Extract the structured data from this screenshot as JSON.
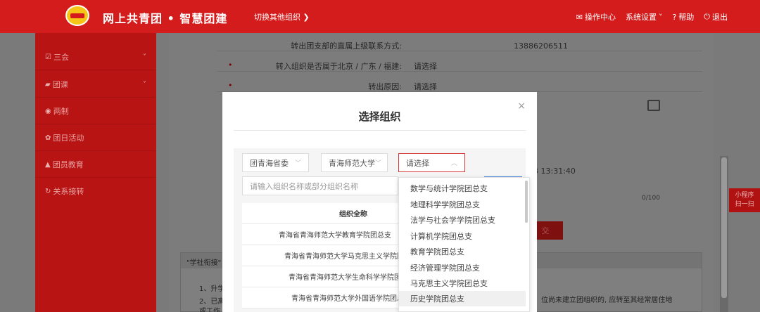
{
  "header": {
    "site_title": "网上共青团 • 智慧团建",
    "switch_org": "切换其他组织",
    "ops_center": "操作中心",
    "settings": "系统设置",
    "help": "帮助",
    "logout": "退出"
  },
  "sidebar": {
    "items": [
      {
        "label": "三会",
        "icon": "checkbox-icon",
        "has_arrow": true
      },
      {
        "label": "团课",
        "icon": "folder-icon",
        "has_arrow": true
      },
      {
        "label": "两制",
        "icon": "circle-icon",
        "has_arrow": false
      },
      {
        "label": "团日活动",
        "icon": "gear-icon",
        "has_arrow": false
      },
      {
        "label": "团员教育",
        "icon": "graduation-icon",
        "has_arrow": false
      },
      {
        "label": "关系接转",
        "icon": "refresh-icon",
        "has_arrow": false
      }
    ]
  },
  "form": {
    "contact_label": "转出团支部的直属上级联系方式:",
    "contact_value": "13886206511",
    "region_label": "转入组织是否属于北京 / 广东 / 福建:",
    "region_value": "请选择",
    "reason_label": "转出原因:",
    "reason_value": "请选择",
    "time_value": "3 13:31:40",
    "counter": "0/100",
    "submit_label": "交"
  },
  "notice": {
    "header": "\"学社衔接\"",
    "line1": "1、升学",
    "line2": "2、已离",
    "line3": "或工作",
    "line_right": "位尚未建立团组织的, 应转至其经常居住地"
  },
  "mini_program": {
    "line1": "小程序",
    "line2": "扫一扫"
  },
  "modal": {
    "title": "选择组织",
    "close": "×",
    "select1": "团青海省委",
    "select2": "青海师范大学",
    "select3": "请选择",
    "search_placeholder": "请输入组织名称或部分组织名称",
    "table_header": "组织全称",
    "rows": [
      "青海省青海师范大学教育学院团总支",
      "青海省青海师范大学马克思主义学院团总支",
      "青海省青海师范大学生命科学学院团总支",
      "青海省青海师范大学外国语学院团总支"
    ]
  },
  "dropdown": {
    "options": [
      "数学与统计学院团总支",
      "地理科学学院团总支",
      "法学与社会学学院团总支",
      "计算机学院团总支",
      "教育学院团总支",
      "经济管理学院团总支",
      "马克思主义学院团总支",
      "历史学院团总支"
    ]
  },
  "colors": {
    "brand_red": "#d41c1c",
    "sidebar_red": "#b81414",
    "accent_blue": "#4e88d8"
  }
}
